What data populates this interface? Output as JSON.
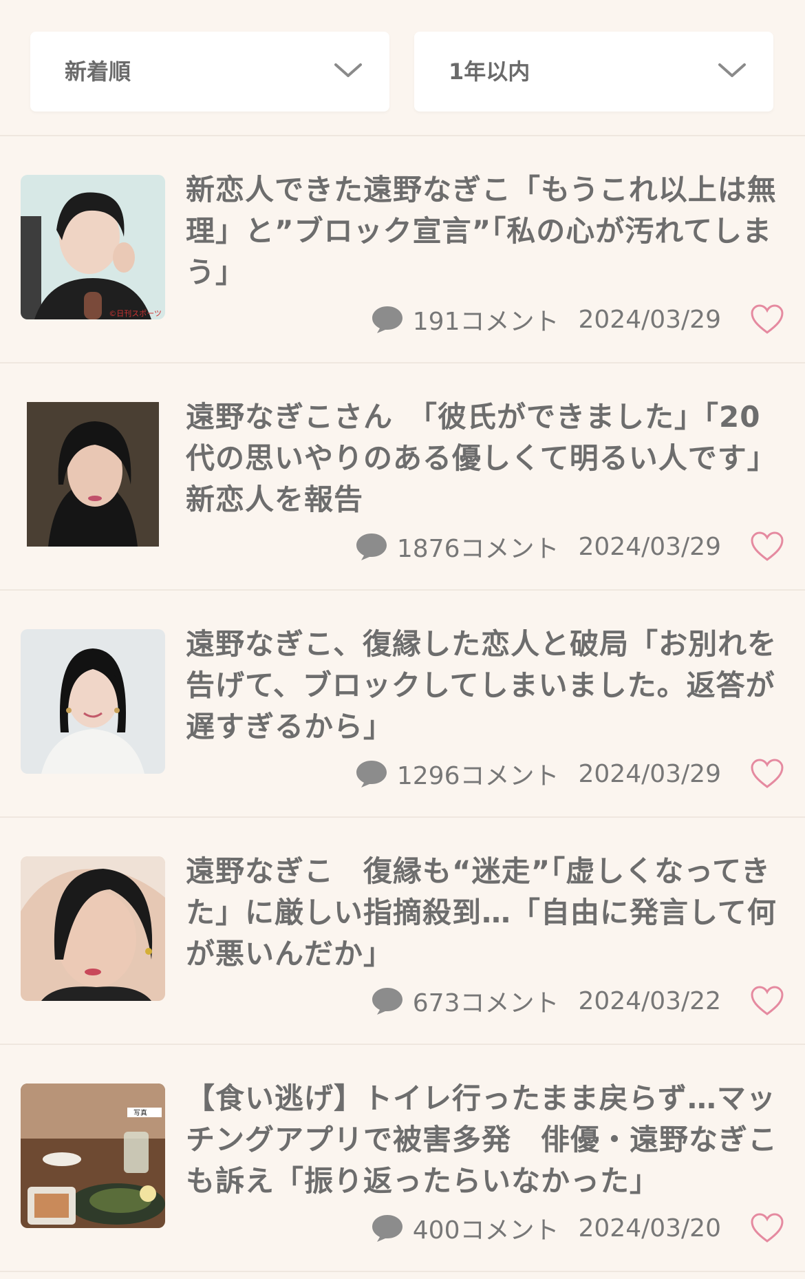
{
  "filters": {
    "sort": {
      "label": "新着順"
    },
    "range": {
      "label": "1年以内"
    }
  },
  "articles": [
    {
      "title": "新恋人できた遠野なぎこ「もうこれ以上は無理」と”ブロック宣言”「私の心が汚れてしまう」",
      "comments": "191コメント",
      "date": "2024/03/29",
      "thumb_credit": "©日刊スポーツ"
    },
    {
      "title": "遠野なぎこさん　「彼氏ができました」「20代の思いやりのある優しくて明るい人です」　新恋人を報告",
      "comments": "1876コメント",
      "date": "2024/03/29"
    },
    {
      "title": "遠野なぎこ、復縁した恋人と破局「お別れを告げて、ブロックしてしまいました。返答が遅すぎるから」",
      "comments": "1296コメント",
      "date": "2024/03/29"
    },
    {
      "title": "遠野なぎこ　復縁も“迷走”「虚しくなってきた」に厳しい指摘殺到…「自由に発言して何が悪いんだか」",
      "comments": "673コメント",
      "date": "2024/03/22"
    },
    {
      "title": "【食い逃げ】トイレ行ったまま戻らず…マッチングアプリで被害多発　俳優・遠野なぎこも訴え「振り返ったらいなかった」",
      "comments": "400コメント",
      "date": "2024/03/20",
      "thumb_credit": "写真"
    }
  ],
  "icons": {
    "chevron": "chevron-down-icon",
    "comment": "comment-bubble-icon",
    "heart": "heart-outline-icon"
  },
  "colors": {
    "background": "#fbf5ef",
    "heart": "#e58aa0",
    "text": "#6d6d6d"
  }
}
